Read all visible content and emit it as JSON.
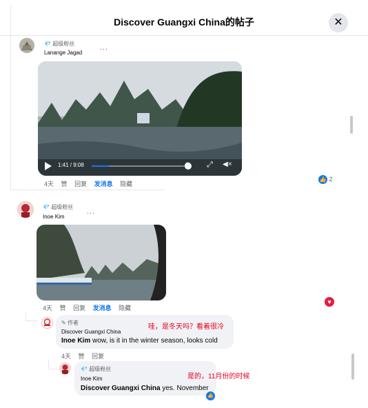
{
  "header": {
    "title": "Discover Guangxi China的帖子",
    "close": "✕"
  },
  "post1": {
    "badge": "超级粉丝",
    "name": "Lanange Jagad",
    "dots": "...",
    "video_time": "1:41 / 9:08",
    "actions": [
      "4天",
      "赞",
      "回复",
      "发消息",
      "隐藏"
    ],
    "reactions": "2"
  },
  "post2": {
    "badge": "超级粉丝",
    "name": "Inoe Kim",
    "dots": "...",
    "actions": [
      "4天",
      "赞",
      "回复",
      "发消息",
      "隐藏"
    ]
  },
  "reply1": {
    "badge": "作者",
    "name": "Discover Guangxi China",
    "author": "Inoe Kim",
    "text": "wow, is it in the winter season, looks cold",
    "translation": "哇，是冬天吗？看着很冷",
    "actions": [
      "4天",
      "赞",
      "回复"
    ]
  },
  "reply2": {
    "badge": "超级粉丝",
    "name": "Inoe Kim",
    "author": "Discover Guangxi China",
    "text": "yes. November",
    "translation": "是的，11月份的时候"
  },
  "colors": {
    "accent": "#1877f2",
    "heart": "#e41e3f",
    "red_annotation": "#e8001c"
  }
}
